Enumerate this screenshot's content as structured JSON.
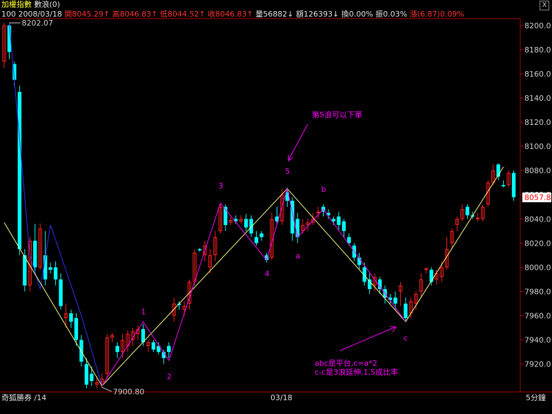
{
  "header": {
    "title": "加權指數",
    "indicator": "數浪(0)",
    "close_symbol": "X"
  },
  "quote": {
    "period_count": "100",
    "date": "2008/03/18",
    "open": "開8045.29↑",
    "high": "高8046.83↑",
    "low": "低8044.52↑",
    "close": "收8046.83↑",
    "volume": "量56882↓",
    "amount": "額126393↓",
    "turnover": "換0.00%",
    "amplitude": "振0.03%",
    "change_label": "漲",
    "change_value": "(6.87)",
    "change_pct": "0.09%"
  },
  "footer": {
    "left": "奇狐勝券 /14",
    "center": "03/18",
    "right": "5分鐘"
  },
  "colors": {
    "up": "#ff2020",
    "down": "#00ffff",
    "axis": "#b00000",
    "trend_yellow": "#ffff88",
    "wave_magenta": "#ff00ff",
    "blue_line": "#3030ff",
    "price_tag_bg": "#ffffff",
    "price_tag_fg": "#ff0000"
  },
  "chart_data": {
    "type": "candlestick",
    "ylim": [
      7897,
      8205
    ],
    "yticks": [
      7920,
      7940,
      7960,
      7980,
      8000,
      8020,
      8040,
      8060,
      8080,
      8100,
      8120,
      8140,
      8160,
      8180,
      8200
    ],
    "ytick_labels": [
      "7920.0",
      "7940.0",
      "7960.0",
      "7980.0",
      "8000.0",
      "8020.0",
      "8040.0",
      "8060.0",
      "8080.0",
      "8100.0",
      "8120.0",
      "8140.0",
      "8160.0",
      "8180.0",
      "8200.0"
    ],
    "n": 100,
    "current_price": "8057.8",
    "current_value": 8057.8,
    "annotations": {
      "high_label": "8202.07",
      "high_index": 1,
      "high_value": 8202.07,
      "low_label": "7900.80",
      "low_index": 19,
      "low_value": 7900.8,
      "note_top": "第5浪可以下單",
      "note_bottom_1": "abc是平台,c=a*2",
      "note_bottom_2": "c-c是3浪延伸,1,5成比率"
    },
    "wave_labels": [
      {
        "text": "1",
        "index": 27,
        "value": 7951
      },
      {
        "text": "2",
        "index": 32,
        "value": 7920
      },
      {
        "text": "3",
        "index": 42,
        "value": 8055
      },
      {
        "text": "4",
        "index": 51,
        "value": 8005
      },
      {
        "text": "5",
        "index": 55,
        "value": 8067
      },
      {
        "text": "a",
        "index": 57,
        "value": 8020
      },
      {
        "text": "b",
        "index": 62,
        "value": 8052
      },
      {
        "text": "c",
        "index": 78,
        "value": 7952
      }
    ],
    "yellow_lines": [
      [
        [
          0,
          8037
        ],
        [
          19,
          7902
        ],
        [
          55,
          8065
        ],
        [
          78,
          7955
        ],
        [
          97,
          8083
        ]
      ]
    ],
    "magenta_lines": [
      [
        [
          19,
          7902
        ],
        [
          27,
          7955
        ],
        [
          32,
          7923
        ],
        [
          42,
          8053
        ],
        [
          51,
          8006
        ],
        [
          55,
          8065
        ],
        [
          57,
          8025
        ],
        [
          62,
          8048
        ],
        [
          78,
          7955
        ]
      ]
    ],
    "blue_lines": [
      [
        [
          1,
          8202
        ],
        [
          5,
          8010
        ],
        [
          7,
          7982
        ],
        [
          9,
          8035
        ],
        [
          15,
          7960
        ],
        [
          19,
          7902
        ]
      ]
    ],
    "candles": [
      {
        "o": 8170,
        "h": 8202,
        "l": 8165,
        "c": 8200
      },
      {
        "o": 8200,
        "h": 8202,
        "l": 8172,
        "c": 8178
      },
      {
        "o": 8168,
        "h": 8170,
        "l": 8150,
        "c": 8155
      },
      {
        "o": 8145,
        "h": 8150,
        "l": 8010,
        "c": 8015
      },
      {
        "o": 8010,
        "h": 8015,
        "l": 7980,
        "c": 7985
      },
      {
        "o": 7985,
        "h": 8025,
        "l": 7980,
        "c": 8022
      },
      {
        "o": 8022,
        "h": 8036,
        "l": 7995,
        "c": 8000
      },
      {
        "o": 8000,
        "h": 8036,
        "l": 7998,
        "c": 8032
      },
      {
        "o": 8010,
        "h": 8030,
        "l": 7985,
        "c": 7990
      },
      {
        "o": 8000,
        "h": 8004,
        "l": 7995,
        "c": 7998
      },
      {
        "o": 8000,
        "h": 8005,
        "l": 7985,
        "c": 7990
      },
      {
        "o": 7990,
        "h": 7995,
        "l": 7965,
        "c": 7968
      },
      {
        "o": 7958,
        "h": 7970,
        "l": 7950,
        "c": 7962
      },
      {
        "o": 7962,
        "h": 7965,
        "l": 7950,
        "c": 7955
      },
      {
        "o": 7958,
        "h": 7962,
        "l": 7935,
        "c": 7940
      },
      {
        "o": 7940,
        "h": 7944,
        "l": 7918,
        "c": 7922
      },
      {
        "o": 7920,
        "h": 7925,
        "l": 7900,
        "c": 7903
      },
      {
        "o": 7912,
        "h": 7918,
        "l": 7902,
        "c": 7906
      },
      {
        "o": 7903,
        "h": 7910,
        "l": 7900,
        "c": 7905
      },
      {
        "o": 7905,
        "h": 7912,
        "l": 7900,
        "c": 7908
      },
      {
        "o": 7912,
        "h": 7945,
        "l": 7908,
        "c": 7942
      },
      {
        "o": 7942,
        "h": 7946,
        "l": 7938,
        "c": 7944
      },
      {
        "o": 7935,
        "h": 7938,
        "l": 7925,
        "c": 7930
      },
      {
        "o": 7930,
        "h": 7945,
        "l": 7925,
        "c": 7940
      },
      {
        "o": 7935,
        "h": 7948,
        "l": 7930,
        "c": 7945
      },
      {
        "o": 7940,
        "h": 7950,
        "l": 7935,
        "c": 7947
      },
      {
        "o": 7945,
        "h": 7952,
        "l": 7940,
        "c": 7949
      },
      {
        "o": 7949,
        "h": 7953,
        "l": 7935,
        "c": 7938
      },
      {
        "o": 7935,
        "h": 7940,
        "l": 7930,
        "c": 7938
      },
      {
        "o": 7938,
        "h": 7940,
        "l": 7930,
        "c": 7932
      },
      {
        "o": 7935,
        "h": 7938,
        "l": 7928,
        "c": 7930
      },
      {
        "o": 7930,
        "h": 7932,
        "l": 7920,
        "c": 7925
      },
      {
        "o": 7935,
        "h": 7938,
        "l": 7925,
        "c": 7930
      },
      {
        "o": 7960,
        "h": 7975,
        "l": 7955,
        "c": 7970
      },
      {
        "o": 7970,
        "h": 7972,
        "l": 7965,
        "c": 7969
      },
      {
        "o": 7965,
        "h": 7972,
        "l": 7960,
        "c": 7968
      },
      {
        "o": 7970,
        "h": 7990,
        "l": 7965,
        "c": 7988
      },
      {
        "o": 7988,
        "h": 8015,
        "l": 7985,
        "c": 8012
      },
      {
        "o": 8015,
        "h": 8016,
        "l": 8013,
        "c": 8014
      },
      {
        "o": 8010,
        "h": 8022,
        "l": 8005,
        "c": 8018
      },
      {
        "o": 8000,
        "h": 8015,
        "l": 7995,
        "c": 8010
      },
      {
        "o": 8010,
        "h": 8030,
        "l": 8005,
        "c": 8025
      },
      {
        "o": 8030,
        "h": 8053,
        "l": 8028,
        "c": 8050
      },
      {
        "o": 8050,
        "h": 8052,
        "l": 8030,
        "c": 8035
      },
      {
        "o": 8037,
        "h": 8042,
        "l": 8035,
        "c": 8039
      },
      {
        "o": 8040,
        "h": 8043,
        "l": 8036,
        "c": 8038
      },
      {
        "o": 8038,
        "h": 8043,
        "l": 8036,
        "c": 8040
      },
      {
        "o": 8040,
        "h": 8044,
        "l": 8030,
        "c": 8033
      },
      {
        "o": 8040,
        "h": 8043,
        "l": 8025,
        "c": 8028
      },
      {
        "o": 8025,
        "h": 8030,
        "l": 8018,
        "c": 8020
      },
      {
        "o": 8028,
        "h": 8030,
        "l": 8022,
        "c": 8025
      },
      {
        "o": 8010,
        "h": 8012,
        "l": 8004,
        "c": 8006
      },
      {
        "o": 8008,
        "h": 8045,
        "l": 8006,
        "c": 8040
      },
      {
        "o": 8042,
        "h": 8050,
        "l": 8035,
        "c": 8038
      },
      {
        "o": 8038,
        "h": 8065,
        "l": 8035,
        "c": 8060
      },
      {
        "o": 8062,
        "h": 8066,
        "l": 8050,
        "c": 8055
      },
      {
        "o": 8055,
        "h": 8058,
        "l": 8022,
        "c": 8028
      },
      {
        "o": 8040,
        "h": 8045,
        "l": 8020,
        "c": 8025
      },
      {
        "o": 8030,
        "h": 8040,
        "l": 8028,
        "c": 8035
      },
      {
        "o": 8035,
        "h": 8040,
        "l": 8030,
        "c": 8037
      },
      {
        "o": 8037,
        "h": 8045,
        "l": 8035,
        "c": 8040
      },
      {
        "o": 8045,
        "h": 8050,
        "l": 8040,
        "c": 8046
      },
      {
        "o": 8050,
        "h": 8052,
        "l": 8042,
        "c": 8046
      },
      {
        "o": 8045,
        "h": 8048,
        "l": 8040,
        "c": 8043
      },
      {
        "o": 8040,
        "h": 8042,
        "l": 8035,
        "c": 8038
      },
      {
        "o": 8042,
        "h": 8046,
        "l": 8030,
        "c": 8035
      },
      {
        "o": 8038,
        "h": 8040,
        "l": 8025,
        "c": 8030
      },
      {
        "o": 8025,
        "h": 8028,
        "l": 8018,
        "c": 8020
      },
      {
        "o": 8018,
        "h": 8020,
        "l": 8005,
        "c": 8008
      },
      {
        "o": 8008,
        "h": 8012,
        "l": 7998,
        "c": 8002
      },
      {
        "o": 8000,
        "h": 8004,
        "l": 7985,
        "c": 7988
      },
      {
        "o": 7990,
        "h": 7995,
        "l": 7978,
        "c": 7982
      },
      {
        "o": 7985,
        "h": 7995,
        "l": 7980,
        "c": 7992
      },
      {
        "o": 7990,
        "h": 7992,
        "l": 7978,
        "c": 7982
      },
      {
        "o": 7982,
        "h": 7985,
        "l": 7970,
        "c": 7975
      },
      {
        "o": 7975,
        "h": 7978,
        "l": 7970,
        "c": 7973
      },
      {
        "o": 7975,
        "h": 7980,
        "l": 7965,
        "c": 7970
      },
      {
        "o": 7980,
        "h": 7988,
        "l": 7968,
        "c": 7985
      },
      {
        "o": 7970,
        "h": 7975,
        "l": 7955,
        "c": 7958
      },
      {
        "o": 7962,
        "h": 7975,
        "l": 7958,
        "c": 7972
      },
      {
        "o": 7970,
        "h": 7980,
        "l": 7965,
        "c": 7978
      },
      {
        "o": 7980,
        "h": 7995,
        "l": 7975,
        "c": 7990
      },
      {
        "o": 7998,
        "h": 8000,
        "l": 7995,
        "c": 7999
      },
      {
        "o": 7998,
        "h": 8000,
        "l": 7985,
        "c": 7988
      },
      {
        "o": 7990,
        "h": 7998,
        "l": 7986,
        "c": 7995
      },
      {
        "o": 7992,
        "h": 8005,
        "l": 7988,
        "c": 8000
      },
      {
        "o": 8000,
        "h": 8025,
        "l": 7998,
        "c": 8015
      },
      {
        "o": 8020,
        "h": 8032,
        "l": 8015,
        "c": 8030
      },
      {
        "o": 8035,
        "h": 8042,
        "l": 8030,
        "c": 8040
      },
      {
        "o": 8040,
        "h": 8052,
        "l": 8038,
        "c": 8048
      },
      {
        "o": 8050,
        "h": 8052,
        "l": 8040,
        "c": 8043
      },
      {
        "o": 8043,
        "h": 8046,
        "l": 8040,
        "c": 8042
      },
      {
        "o": 8040,
        "h": 8045,
        "l": 8038,
        "c": 8041
      },
      {
        "o": 8040,
        "h": 8052,
        "l": 8038,
        "c": 8050
      },
      {
        "o": 8052,
        "h": 8072,
        "l": 8050,
        "c": 8070
      },
      {
        "o": 8070,
        "h": 8085,
        "l": 8068,
        "c": 8080
      },
      {
        "o": 8085,
        "h": 8086,
        "l": 8072,
        "c": 8075
      },
      {
        "o": 8068,
        "h": 8072,
        "l": 8066,
        "c": 8067
      },
      {
        "o": 8068,
        "h": 8080,
        "l": 8066,
        "c": 8078
      },
      {
        "o": 8078,
        "h": 8080,
        "l": 8055,
        "c": 8058
      }
    ]
  }
}
